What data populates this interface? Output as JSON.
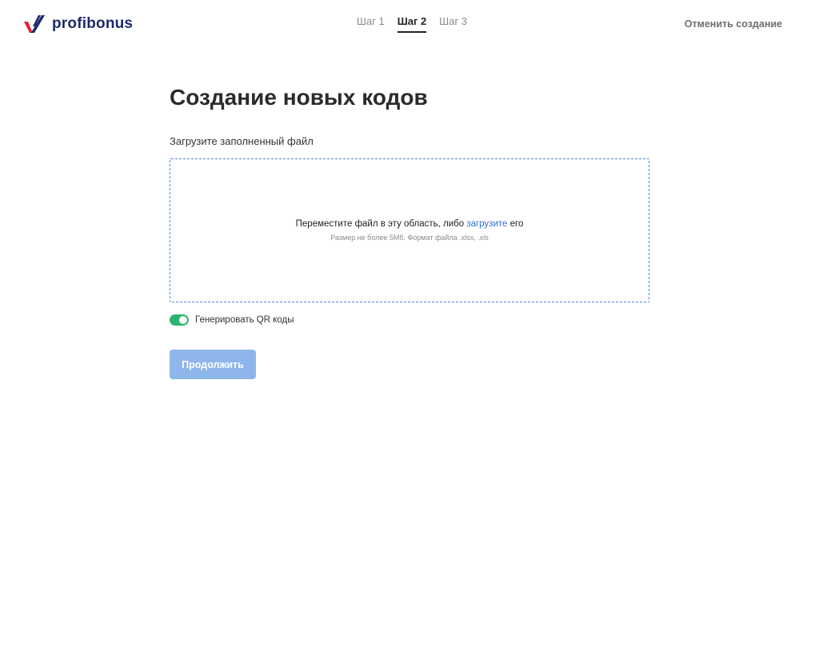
{
  "header": {
    "logo_text": "profibonus",
    "logo_icon": "profibonus-logo-icon",
    "steps": [
      {
        "label": "Шаг 1",
        "active": false
      },
      {
        "label": "Шаг 2",
        "active": true
      },
      {
        "label": "Шаг 3",
        "active": false
      }
    ],
    "cancel_label": "Отменить создание"
  },
  "main": {
    "title": "Создание новых кодов",
    "upload_label": "Загрузите заполненный файл",
    "dropzone": {
      "text_before": "Переместите файл в эту область, либо ",
      "link_text": "загрузите",
      "text_after": " его",
      "hint": "Размер не более 5Мб. Формат файла .xlsx, .xls"
    },
    "qr_toggle": {
      "label": "Генерировать QR коды",
      "enabled": true
    },
    "continue_label": "Продолжить"
  },
  "colors": {
    "brand": "#1c2b6b",
    "accent_red": "#e5262b",
    "link": "#2f6fd0",
    "toggle_on": "#2ab573",
    "button_disabled": "#8fb6eb",
    "dropzone_border": "#4a8fe0"
  }
}
